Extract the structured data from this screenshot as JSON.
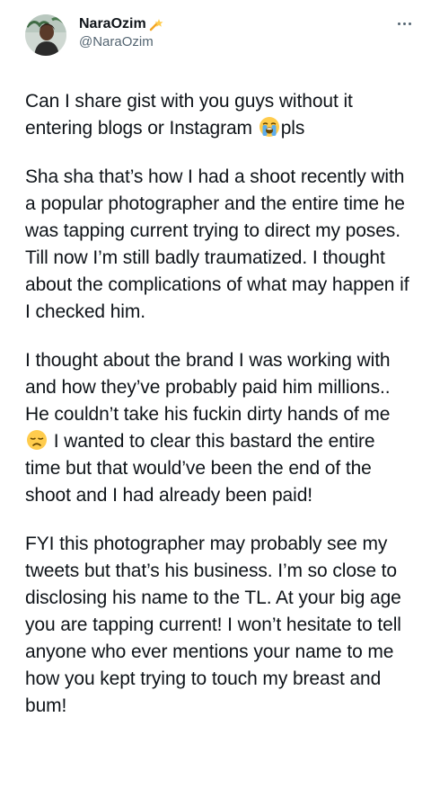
{
  "author": {
    "display_name": "NaraOzim",
    "handle": "@NaraOzim",
    "name_emoji": "shooting-star-emoji",
    "avatar": "avatar-photo"
  },
  "actions": {
    "more_icon": "more-horizontal-icon"
  },
  "tweet": {
    "p1_a": "Can I share gist with you guys without it entering blogs or Instagram",
    "p1_emoji": "loudly-crying-face-emoji",
    "p1_b": "pls",
    "p2": "Sha sha that’s how I had a shoot recently with a popular photographer and the entire time he was tapping current trying to direct my poses. Till now I’m still badly traumatized. I thought about the complications of what may happen if I checked him.",
    "p3_a": "I thought about the brand I was working with and how they’ve probably paid him millions.. He couldn’t take his fuckin dirty hands of me",
    "p3_emoji": "disappointed-face-emoji",
    "p3_b": " I wanted to clear this bastard the entire time but that would’ve been the end of the shoot and I had already been paid!",
    "p4": "FYI this photographer may probably see my tweets but that’s his business. I’m so close to disclosing his name to the TL. At your big age you are tapping current! I won’t hesitate to tell anyone who ever mentions your name  to me how you kept trying to touch my breast and bum!"
  },
  "colors": {
    "text": "#0f1419",
    "secondary": "#536471",
    "background": "#ffffff",
    "emoji_yellow": "#ffcc4d"
  }
}
